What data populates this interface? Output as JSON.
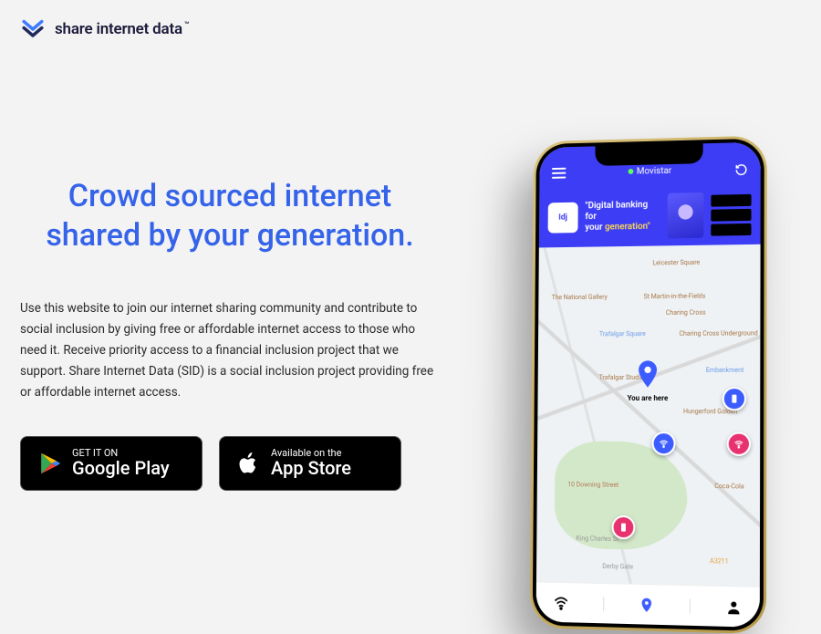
{
  "header": {
    "brand": "share internet data",
    "trademark": "™"
  },
  "hero": {
    "headline": "Crowd sourced internet shared by your generation.",
    "body": "Use this website to join our internet sharing community and contribute to social inclusion by giving free or affordable internet access to those who need it. Receive priority access to a financial inclusion project that we support. Share Internet Data (SID) is a social inclusion project providing free or affordable internet access."
  },
  "store": {
    "google": {
      "line1": "GET IT ON",
      "line2": "Google Play"
    },
    "apple": {
      "line1": "Available on the",
      "line2": "App Store"
    }
  },
  "phone": {
    "carrier": "Movistar",
    "banner_logo": "Idj",
    "banner_line1": "\"Digital banking for",
    "banner_line2_prefix": "your ",
    "banner_line2_highlight": "generation\"",
    "you_are_here": "You are here",
    "map_labels": {
      "leicester": "Leicester Square",
      "national_gallery": "The National Gallery",
      "st_martin": "St Martin-in-the-Fields",
      "charing_cross": "Charing Cross",
      "charing_cross_u": "Charing Cross Underground",
      "trafalgar": "Trafalgar Square",
      "trafalgar_studios": "Trafalgar Studios",
      "embankment": "Embankment",
      "hungerford": "Hungerford Golden",
      "downing": "10 Downing Street",
      "coca": "Coca-Cola",
      "king_charles": "King Charles St",
      "derby": "Derby Gate",
      "a3211": "A3211"
    }
  }
}
